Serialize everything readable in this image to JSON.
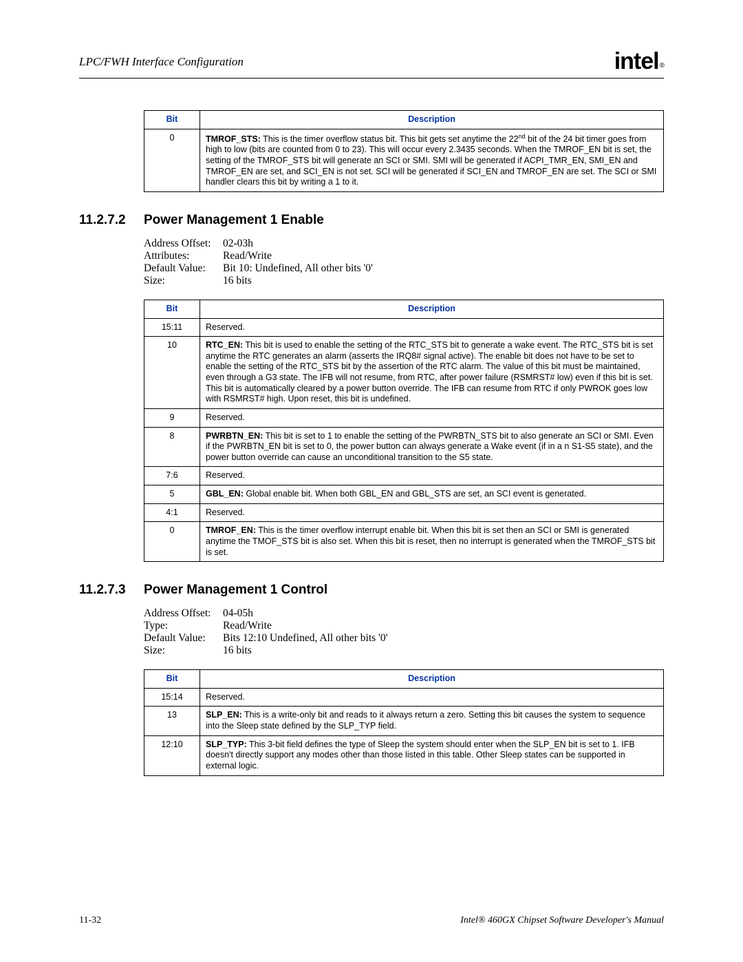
{
  "header": {
    "title": "LPC/FWH Interface Configuration",
    "logo_text": "intel",
    "logo_r": "®"
  },
  "table1": {
    "head_bit": "Bit",
    "head_desc": "Description",
    "rows": [
      {
        "bit": "0",
        "lead": "TMROF_STS:",
        "text_a": " This is the timer overflow status bit. This bit gets set anytime the 22",
        "sup": "nd",
        "text_b": " bit of the 24 bit timer goes from high to low (bits are counted from 0 to 23). This will occur every 2.3435 seconds. When the TMROF_EN bit is set, the setting of the TMROF_STS bit will generate an SCI or SMI. SMI will be generated if ACPI_TMR_EN, SMI_EN and TMROF_EN are set, and SCI_EN is not set. SCI will be generated if SCI_EN and TMROF_EN are set. The SCI or SMI handler clears this bit by writing a 1 to it."
      }
    ]
  },
  "section2": {
    "number": "11.2.7.2",
    "title": "Power Management 1 Enable",
    "attrs": [
      {
        "label": "Address Offset:",
        "value": "02-03h"
      },
      {
        "label": "Attributes:",
        "value": "Read/Write"
      },
      {
        "label": "Default Value:",
        "value": "Bit 10: Undefined, All other bits '0'"
      },
      {
        "label": "Size:",
        "value": "16 bits"
      }
    ]
  },
  "table2": {
    "head_bit": "Bit",
    "head_desc": "Description",
    "rows": [
      {
        "bit": "15:11",
        "lead": "",
        "text": "Reserved."
      },
      {
        "bit": "10",
        "lead": "RTC_EN:",
        "text": " This bit is used to enable the setting of the RTC_STS bit to generate a wake event. The RTC_STS bit is set anytime the RTC generates an alarm (asserts the IRQ8# signal active). The enable bit does not have to be set to enable the setting of the RTC_STS bit by the assertion of the RTC alarm. The value of this bit must be maintained, even through a G3 state. The IFB will not resume, from RTC, after power failure (RSMRST# low) even if this bit is set. This bit is automatically cleared by a power button override. The IFB can resume from RTC if only PWROK goes low with RSMRST# high. Upon reset, this bit is undefined."
      },
      {
        "bit": "9",
        "lead": "",
        "text": "Reserved."
      },
      {
        "bit": "8",
        "lead": "PWRBTN_EN:",
        "text": " This bit is set to 1 to enable the setting of the PWRBTN_STS bit to also generate an SCI or SMI. Even if the PWRBTN_EN bit is set to 0, the power button can always generate a Wake event (if in a n S1-S5 state), and the power button override can cause an unconditional transition to the S5 state."
      },
      {
        "bit": "7:6",
        "lead": "",
        "text": "Reserved."
      },
      {
        "bit": "5",
        "lead": "GBL_EN:",
        "text": " Global enable bit. When both GBL_EN and GBL_STS are set, an SCI event is generated."
      },
      {
        "bit": "4:1",
        "lead": "",
        "text": "Reserved."
      },
      {
        "bit": "0",
        "lead": "TMROF_EN:",
        "text": " This is the timer overflow interrupt enable bit. When this bit is set then an SCI or SMI is generated anytime the TMOF_STS bit is also set. When this bit is reset, then no interrupt is generated when the TMROF_STS bit is set."
      }
    ]
  },
  "section3": {
    "number": "11.2.7.3",
    "title": "Power Management 1 Control",
    "attrs": [
      {
        "label": "Address Offset:",
        "value": "04-05h"
      },
      {
        "label": "Type:",
        "value": "Read/Write"
      },
      {
        "label": "Default Value:",
        "value": "Bits 12:10 Undefined, All other bits '0'"
      },
      {
        "label": "Size:",
        "value": "16 bits"
      }
    ]
  },
  "table3": {
    "head_bit": "Bit",
    "head_desc": "Description",
    "rows": [
      {
        "bit": "15:14",
        "lead": "",
        "text": "Reserved."
      },
      {
        "bit": "13",
        "lead": "SLP_EN:",
        "text": " This is a write-only bit and reads to it always return a zero. Setting this bit causes the system to sequence into the Sleep state defined by the SLP_TYP field."
      },
      {
        "bit": "12:10",
        "lead": "SLP_TYP:",
        "text": " This 3-bit field defines the type of Sleep the system should enter when the SLP_EN bit is set to 1. IFB doesn't directly support any modes other than those listed in this table. Other Sleep states can be supported in external logic."
      }
    ]
  },
  "footer": {
    "left": "11-32",
    "right": "Intel® 460GX Chipset Software Developer's Manual"
  }
}
